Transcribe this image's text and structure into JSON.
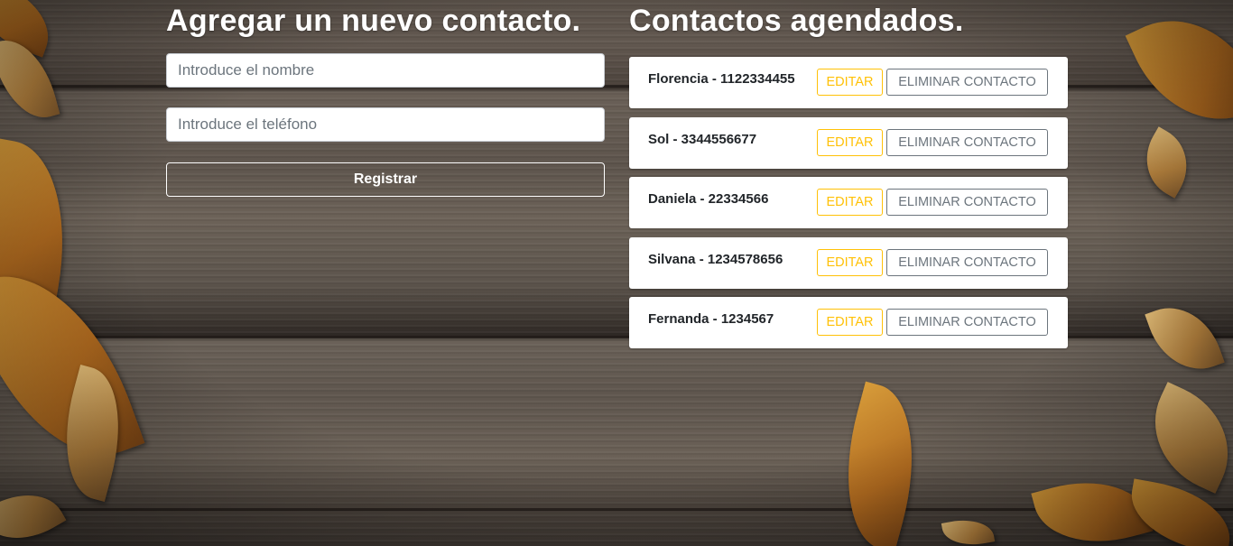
{
  "form": {
    "heading": "Agregar un nuevo contacto.",
    "name_placeholder": "Introduce el nombre",
    "phone_placeholder": "Introduce el teléfono",
    "name_value": "",
    "phone_value": "",
    "register_label": "Registrar"
  },
  "contacts": {
    "heading": "Contactos agendados.",
    "items": [
      {
        "text": "Florencia - 1122334455",
        "edit_label": "EDITAR",
        "delete_label": "ELIMINAR CONTACTO"
      },
      {
        "text": "Sol - 3344556677",
        "edit_label": "EDITAR",
        "delete_label": "ELIMINAR CONTACTO"
      },
      {
        "text": "Daniela - 22334566",
        "edit_label": "EDITAR",
        "delete_label": "ELIMINAR CONTACTO"
      },
      {
        "text": "Silvana - 1234578656",
        "edit_label": "EDITAR",
        "delete_label": "ELIMINAR CONTACTO"
      },
      {
        "text": "Fernanda - 1234567",
        "edit_label": "EDITAR",
        "delete_label": "ELIMINAR CONTACTO"
      }
    ]
  },
  "colors": {
    "edit_accent": "#ffc107",
    "delete_accent": "#6c757d",
    "heading_text": "#ffffff"
  }
}
